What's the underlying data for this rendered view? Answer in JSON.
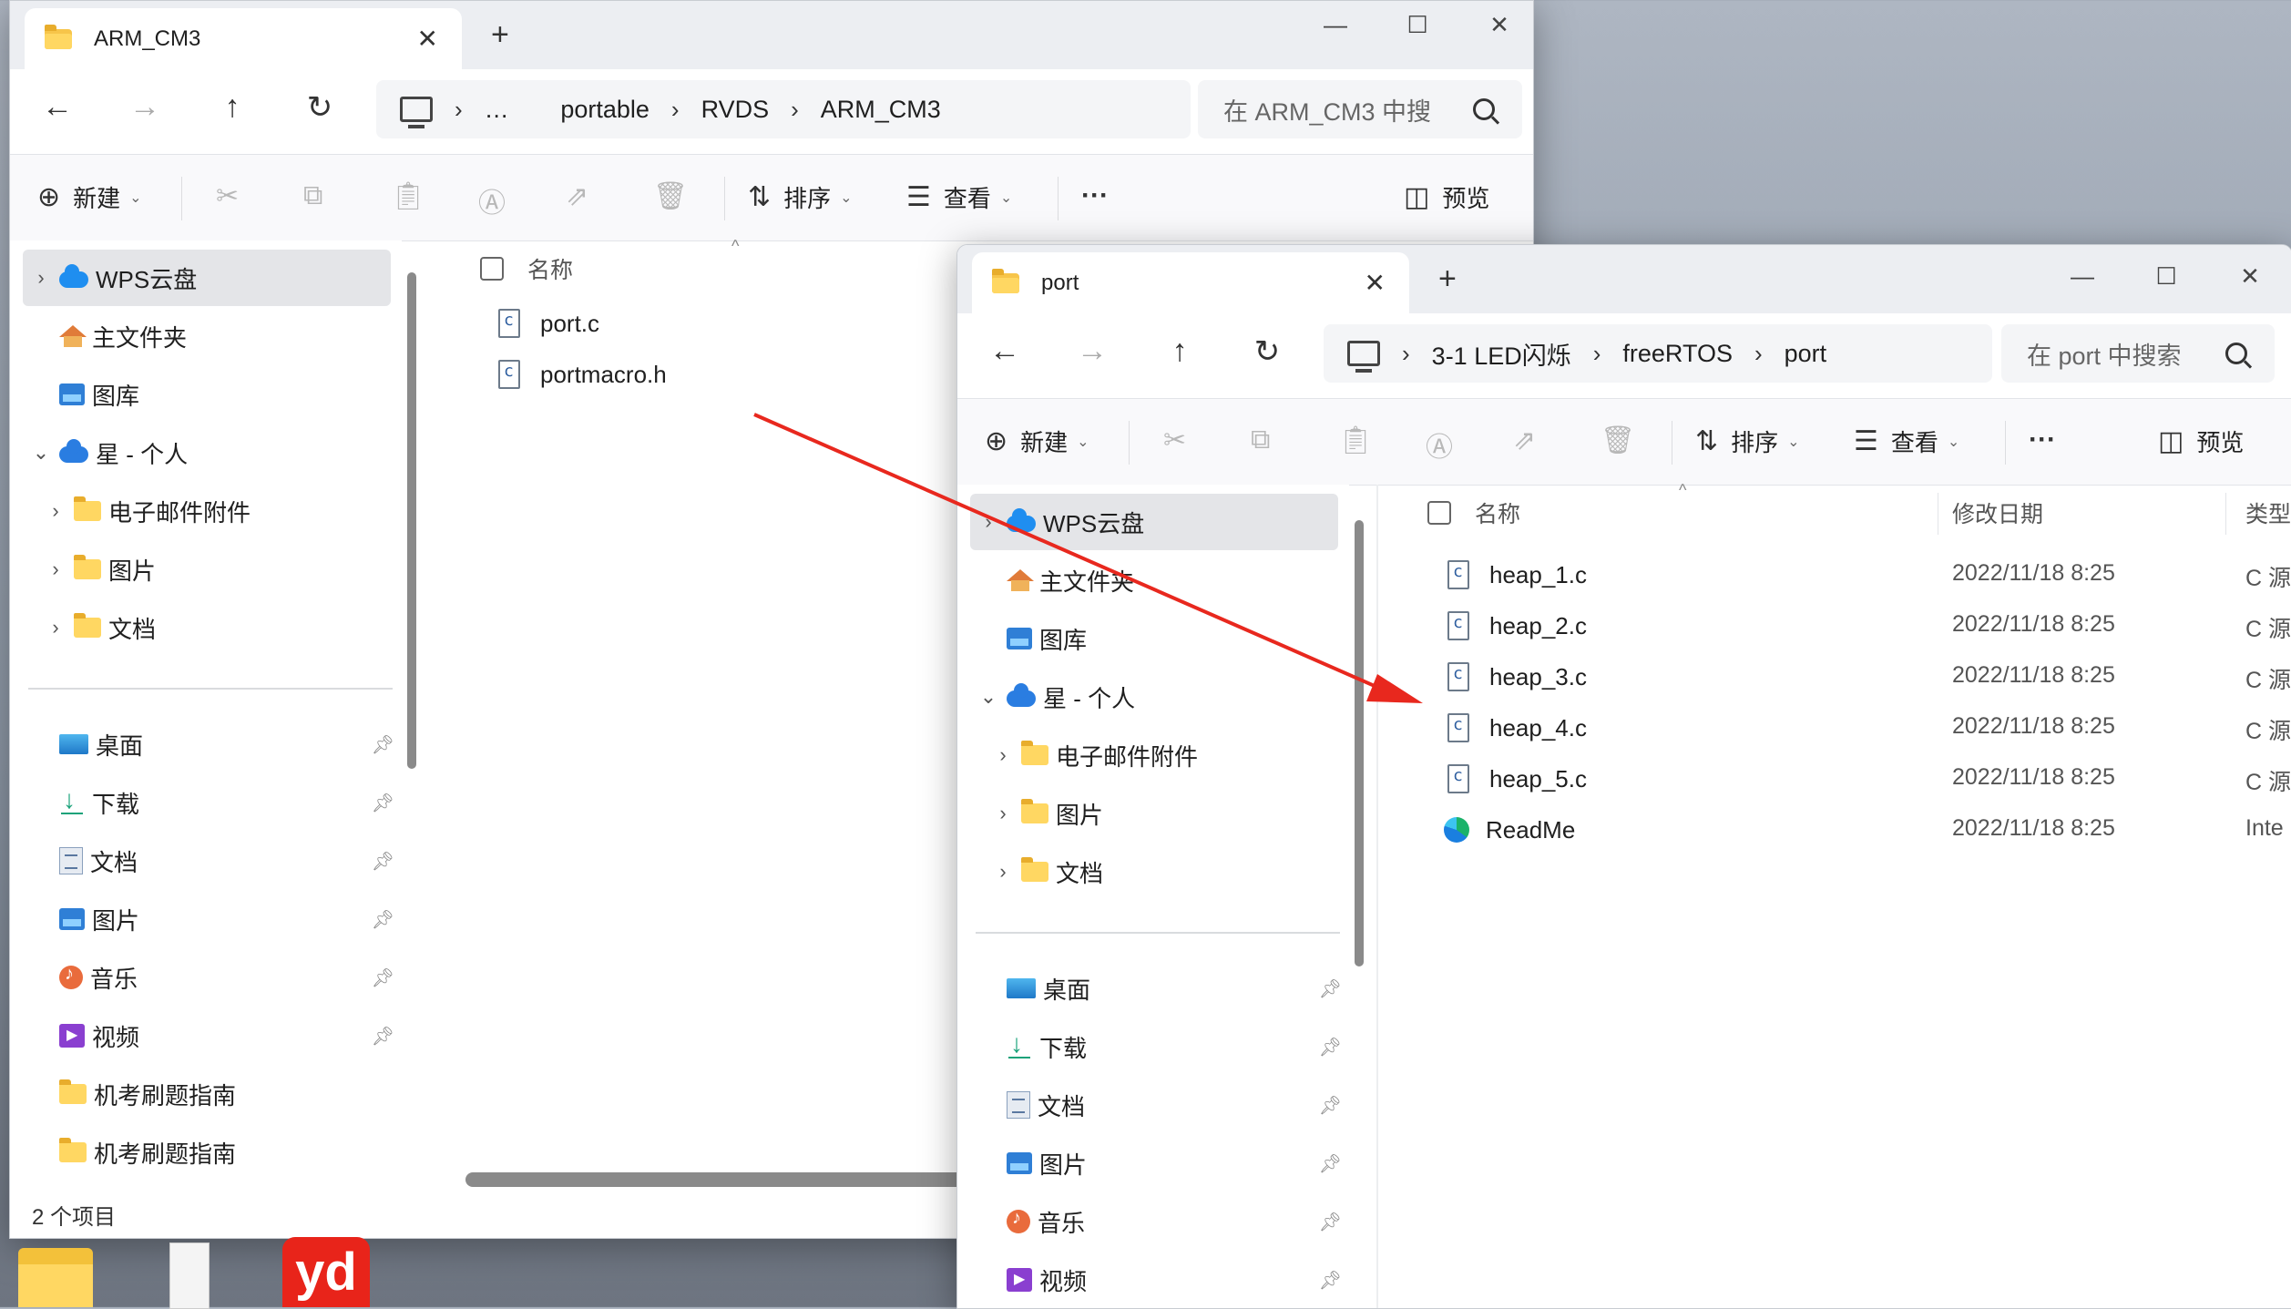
{
  "window1": {
    "tab_title": "ARM_CM3",
    "tab_add": "+",
    "tab_close": "✕",
    "controls": {
      "minimize": "—",
      "maximize": "☐",
      "close": "✕"
    },
    "nav": {
      "back": "←",
      "forward": "→",
      "up": "↑",
      "refresh": "↻"
    },
    "breadcrumb": [
      "…",
      "portable",
      "RVDS",
      "ARM_CM3"
    ],
    "search_placeholder": "在 ARM_CM3 中搜",
    "toolbar": {
      "new": "新建",
      "sort": "排序",
      "view": "查看",
      "more": "···",
      "preview": "预览"
    },
    "sidebar": {
      "cloud": [
        {
          "label": "WPS云盘"
        },
        {
          "label": "主文件夹"
        },
        {
          "label": "图库"
        },
        {
          "label": "星 - 个人"
        },
        {
          "label": "电子邮件附件"
        },
        {
          "label": "图片"
        },
        {
          "label": "文档"
        }
      ],
      "quick": [
        {
          "label": "桌面"
        },
        {
          "label": "下载"
        },
        {
          "label": "文档"
        },
        {
          "label": "图片"
        },
        {
          "label": "音乐"
        },
        {
          "label": "视频"
        },
        {
          "label": "机考刷题指南"
        },
        {
          "label": "机考刷题指南"
        }
      ]
    },
    "column_name": "名称",
    "files": [
      {
        "name": "port.c"
      },
      {
        "name": "portmacro.h"
      }
    ],
    "status": "2 个项目"
  },
  "window2": {
    "tab_title": "port",
    "tab_add": "+",
    "tab_close": "✕",
    "controls": {
      "minimize": "—",
      "maximize": "☐",
      "close": "✕"
    },
    "nav": {
      "back": "←",
      "forward": "→",
      "up": "↑",
      "refresh": "↻"
    },
    "breadcrumb": [
      "3-1 LED闪烁",
      "freeRTOS",
      "port"
    ],
    "search_placeholder": "在 port 中搜索",
    "toolbar": {
      "new": "新建",
      "sort": "排序",
      "view": "查看",
      "more": "···",
      "preview": "预览"
    },
    "sidebar": {
      "cloud": [
        {
          "label": "WPS云盘"
        },
        {
          "label": "主文件夹"
        },
        {
          "label": "图库"
        },
        {
          "label": "星 - 个人"
        },
        {
          "label": "电子邮件附件"
        },
        {
          "label": "图片"
        },
        {
          "label": "文档"
        }
      ],
      "quick": [
        {
          "label": "桌面"
        },
        {
          "label": "下载"
        },
        {
          "label": "文档"
        },
        {
          "label": "图片"
        },
        {
          "label": "音乐"
        },
        {
          "label": "视频"
        }
      ]
    },
    "columns": {
      "name": "名称",
      "date": "修改日期",
      "type": "类型"
    },
    "files": [
      {
        "name": "heap_1.c",
        "date": "2022/11/18 8:25",
        "type": "C 源"
      },
      {
        "name": "heap_2.c",
        "date": "2022/11/18 8:25",
        "type": "C 源"
      },
      {
        "name": "heap_3.c",
        "date": "2022/11/18 8:25",
        "type": "C 源"
      },
      {
        "name": "heap_4.c",
        "date": "2022/11/18 8:25",
        "type": "C 源"
      },
      {
        "name": "heap_5.c",
        "date": "2022/11/18 8:25",
        "type": "C 源"
      },
      {
        "name": "ReadMe",
        "date": "2022/11/18 8:25",
        "type": "Inte"
      }
    ]
  },
  "taskbar": {
    "yd_label": "yd"
  },
  "colors": {
    "arrow": "#e8281e",
    "accent": "#2a7de1",
    "folder": "#ffd762"
  }
}
